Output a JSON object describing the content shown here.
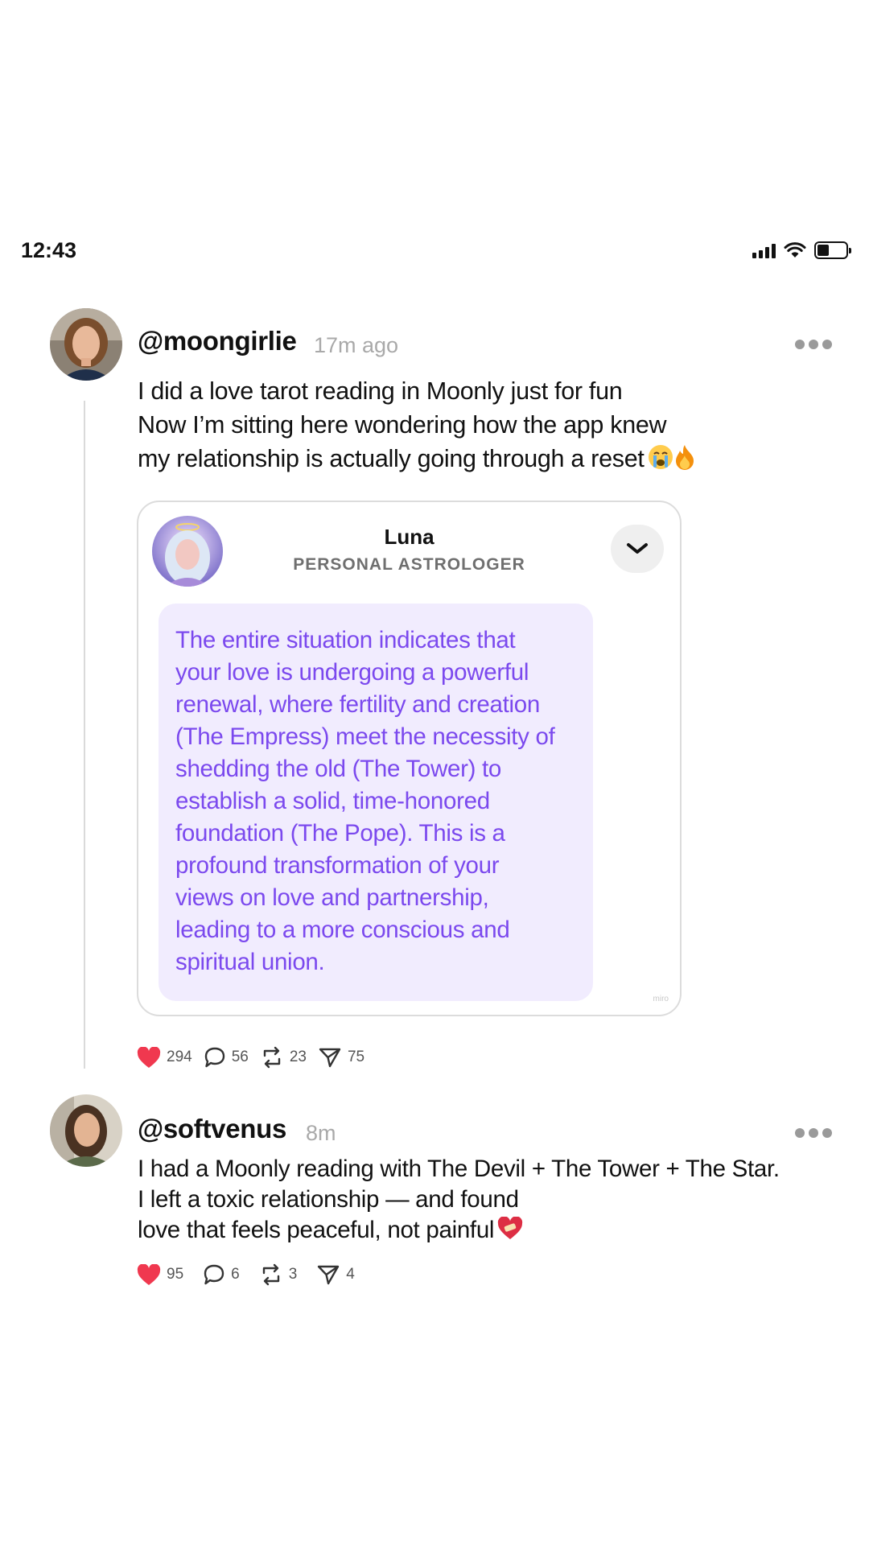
{
  "status_bar": {
    "time": "12:43"
  },
  "posts": [
    {
      "handle": "@moongirlie",
      "time": "17m ago",
      "text_lines": [
        "I did a love tarot reading in Moonly just for fun",
        "Now I’m sitting here wondering how the app knew",
        "my relationship is actually going through a reset"
      ],
      "emojis": [
        "crying-face",
        "fire"
      ],
      "card": {
        "name": "Luna",
        "role": "PERSONAL ASTROLOGER",
        "message_lines": [
          "The entire situation indicates that",
          "your love is undergoing a powerful",
          "renewal, where fertility and creation",
          "(The Empress) meet the necessity of",
          "shedding the old (The Tower) to",
          "establish a solid, time-honored",
          "foundation (The Pope). This is a",
          "profound transformation of your",
          "views on love and partnership,",
          "leading to a more conscious and",
          "spiritual union."
        ],
        "watermark": "miro"
      },
      "stats": {
        "likes": "294",
        "comments": "56",
        "reposts": "23",
        "shares": "75"
      }
    },
    {
      "handle": "@softvenus",
      "time": "8m",
      "text_lines": [
        "I had a Moonly reading with The Devil + The Tower + The Star.",
        "I left a toxic relationship — and found",
        "love that feels peaceful, not painful"
      ],
      "emojis": [
        "mending-heart"
      ],
      "stats": {
        "likes": "95",
        "comments": "6",
        "reposts": "3",
        "shares": "4"
      }
    }
  ],
  "colors": {
    "accent_purple": "#7b49ee",
    "bubble_bg": "#f1ecfe",
    "like_red": "#f0384f"
  }
}
